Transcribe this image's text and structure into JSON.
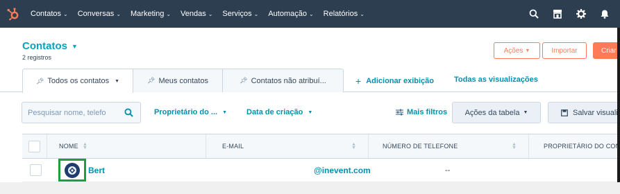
{
  "colors": {
    "nav_bg": "#2d3e50",
    "brand_orange": "#ff7a59",
    "link_teal": "#0091ae",
    "title_teal": "#00a4bd",
    "text": "#33475b",
    "highlight_green": "#1f9e3f"
  },
  "topnav": {
    "logo_icon": "hubspot-sprocket-icon",
    "items": [
      {
        "label": "Contatos"
      },
      {
        "label": "Conversas"
      },
      {
        "label": "Marketing"
      },
      {
        "label": "Vendas"
      },
      {
        "label": "Serviços"
      },
      {
        "label": "Automação"
      },
      {
        "label": "Relatórios"
      }
    ],
    "right_icons": [
      "search-icon",
      "marketplace-icon",
      "settings-gear-icon",
      "notifications-bell-icon"
    ]
  },
  "header": {
    "title": "Contatos",
    "record_count": "2 registros",
    "actions_label": "Ações",
    "import_label": "Importar",
    "create_label": "Criar c"
  },
  "tabs": [
    {
      "label": "Todos os contatos",
      "active": true
    },
    {
      "label": "Meus contatos",
      "active": false
    },
    {
      "label": "Contatos não atribuí...",
      "active": false
    }
  ],
  "view_links": {
    "add_view": "Adicionar exibição",
    "all_views": "Todas as visualizações"
  },
  "filters": {
    "search_placeholder": "Pesquisar nome, telefo",
    "owner": "Proprietário do ...",
    "created_date": "Data de criação",
    "more_filters": "Mais filtros",
    "table_actions": "Ações da tabela",
    "save_view": "Salvar visualiza"
  },
  "table": {
    "columns": [
      "NOME",
      "E-MAIL",
      "NÚMERO DE TELEFONE",
      "PROPRIETÁRIO DO CON"
    ],
    "rows": [
      {
        "name": "Bert",
        "email": "@inevent.com",
        "phone": "--",
        "owner": ""
      }
    ]
  }
}
